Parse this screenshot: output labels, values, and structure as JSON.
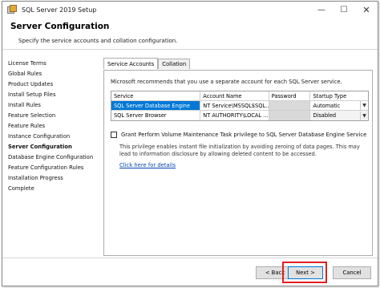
{
  "window": {
    "title": "SQL Server 2019 Setup",
    "controls": {
      "minimize": "—",
      "maximize": "☐",
      "close": "✕"
    }
  },
  "header": {
    "title": "Server Configuration",
    "subtitle": "Specify the service accounts and collation configuration."
  },
  "nav": {
    "items": [
      {
        "label": "License Terms",
        "active": false
      },
      {
        "label": "Global Rules",
        "active": false
      },
      {
        "label": "Product Updates",
        "active": false
      },
      {
        "label": "Install Setup Files",
        "active": false
      },
      {
        "label": "Install Rules",
        "active": false
      },
      {
        "label": "Feature Selection",
        "active": false
      },
      {
        "label": "Feature Rules",
        "active": false
      },
      {
        "label": "Instance Configuration",
        "active": false
      },
      {
        "label": "Server Configuration",
        "active": true
      },
      {
        "label": "Database Engine Configuration",
        "active": false
      },
      {
        "label": "Feature Configuration Rules",
        "active": false
      },
      {
        "label": "Installation Progress",
        "active": false
      },
      {
        "label": "Complete",
        "active": false
      }
    ]
  },
  "tabs": [
    {
      "label": "Service Accounts",
      "active": true
    },
    {
      "label": "Collation",
      "active": false
    }
  ],
  "service_accounts": {
    "recommendation": "Microsoft recommends that you use a separate account for each SQL Server service.",
    "columns": [
      "Service",
      "Account Name",
      "Password",
      "Startup Type"
    ],
    "rows": [
      {
        "service": "SQL Server Database Engine",
        "account": "NT Service\\MSSQL$SQL...",
        "password": "",
        "startup": "Automatic",
        "selected": true
      },
      {
        "service": "SQL Server Browser",
        "account": "NT AUTHORITY\\LOCAL ...",
        "password": "",
        "startup": "Disabled",
        "selected": false
      }
    ],
    "grant_checkbox": {
      "label": "Grant Perform Volume Maintenance Task privilege to SQL Server Database Engine Service",
      "checked": false
    },
    "description": "This privilege enables instant file initialization by avoiding zeroing of data pages. This may lead to information disclosure by allowing deleted content to be accessed.",
    "details_link": "Click here for details"
  },
  "footer": {
    "back_label": "< Back",
    "next_label": "Next >",
    "cancel_label": "Cancel"
  },
  "colors": {
    "selection": "#0078d7",
    "highlight": "#e02020",
    "link": "#0645ad"
  }
}
